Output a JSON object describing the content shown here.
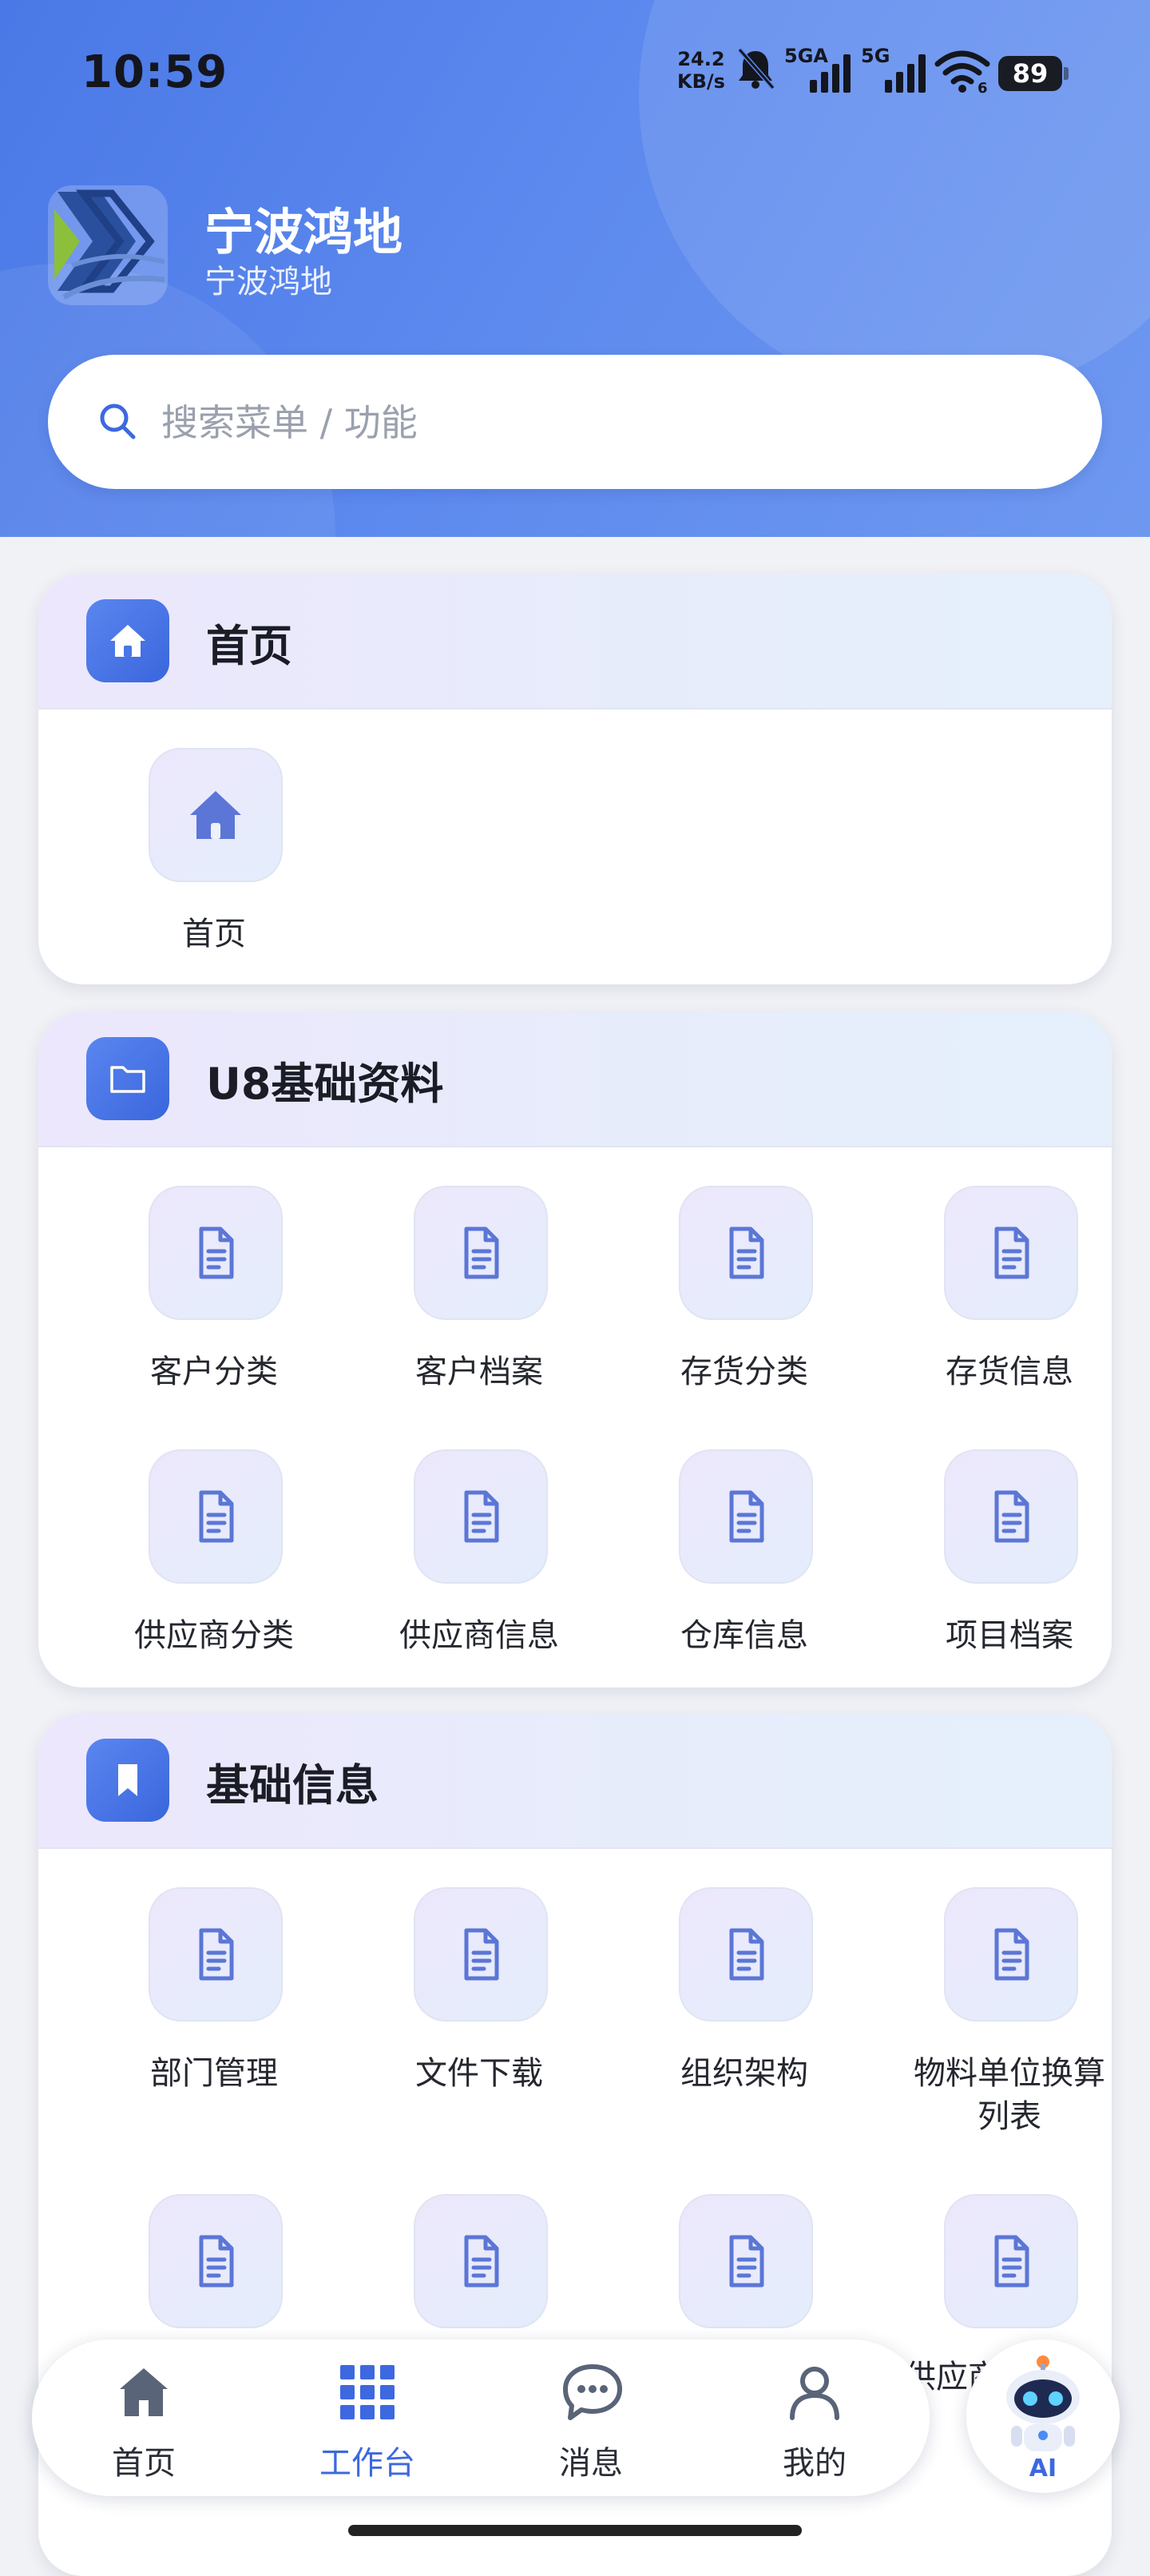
{
  "status_bar": {
    "time": "10:59",
    "net_speed_value": "24.2",
    "net_speed_unit": "KB/s",
    "sim1": "5GA",
    "sim2": "5G",
    "wifi_level": "6",
    "battery": "89"
  },
  "app": {
    "title": "宁波鸿地",
    "subtitle": "宁波鸿地"
  },
  "search": {
    "placeholder": "搜索菜单 / 功能"
  },
  "sections": [
    {
      "title": "首页",
      "icon": "home-icon",
      "items": [
        {
          "label": "首页",
          "icon": "home-icon"
        }
      ]
    },
    {
      "title": "U8基础资料",
      "icon": "folder-icon",
      "items": [
        {
          "label": "客户分类",
          "icon": "document-icon"
        },
        {
          "label": "客户档案",
          "icon": "document-icon"
        },
        {
          "label": "存货分类",
          "icon": "document-icon"
        },
        {
          "label": "存货信息",
          "icon": "document-icon"
        },
        {
          "label": "供应商分类",
          "icon": "document-icon"
        },
        {
          "label": "供应商信息",
          "icon": "document-icon"
        },
        {
          "label": "仓库信息",
          "icon": "document-icon"
        },
        {
          "label": "项目档案",
          "icon": "document-icon"
        }
      ]
    },
    {
      "title": "基础信息",
      "icon": "bookmark-icon",
      "items": [
        {
          "label": "部门管理",
          "icon": "document-icon"
        },
        {
          "label": "文件下载",
          "icon": "document-icon"
        },
        {
          "label": "组织架构",
          "icon": "document-icon"
        },
        {
          "label": "物料单位换算",
          "label2": "列表",
          "icon": "document-icon"
        },
        {
          "label": "",
          "icon": "document-icon"
        },
        {
          "label": "",
          "icon": "document-icon"
        },
        {
          "label": "",
          "icon": "document-icon"
        },
        {
          "label": "",
          "partial_label": "供应商",
          "icon": "document-icon"
        }
      ]
    }
  ],
  "tabbar": {
    "tabs": [
      {
        "label": "首页",
        "icon": "home-icon",
        "active": false
      },
      {
        "label": "工作台",
        "icon": "grid-icon",
        "active": true
      },
      {
        "label": "消息",
        "icon": "chat-icon",
        "active": false
      },
      {
        "label": "我的",
        "icon": "user-icon",
        "active": false
      }
    ],
    "ai_label": "AI"
  },
  "colors": {
    "header_blue": "#5582ec",
    "accent": "#3d68e0",
    "icon_blue": "#5b76d6"
  }
}
